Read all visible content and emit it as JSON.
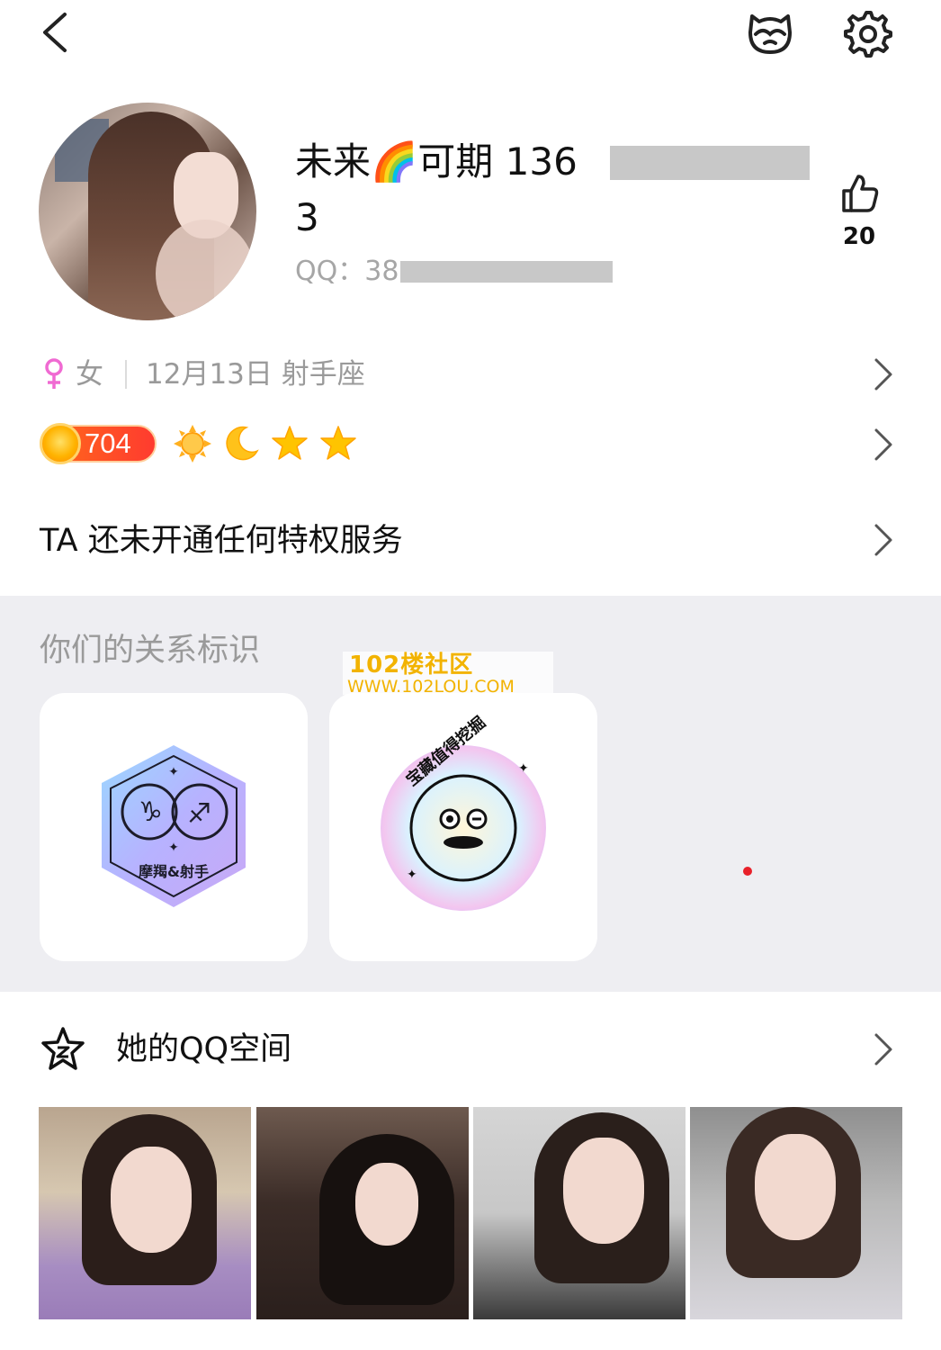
{
  "top_bar": {
    "back_icon": "chevron-left-icon",
    "pet_icon": "pet-face-icon",
    "settings_icon": "gear-icon"
  },
  "profile": {
    "name": "未来🌈可期 136",
    "name_cont": "3",
    "qq_label": "QQ：38",
    "like_count": "20"
  },
  "info": {
    "gender_symbol": "♀",
    "gender": "女",
    "birthday": "12月13日 射手座",
    "level": "704",
    "privilege": "TA 还未开通任何特权服务"
  },
  "relation": {
    "title": "你们的关系标识",
    "watermark_line1": "102楼社区",
    "watermark_line2": "WWW.102LOU.COM",
    "cards": [
      {
        "badge_label": "摩羯&射手",
        "icon": "zodiac-badge-icon"
      },
      {
        "badge_label": "宝藏值得挖掘",
        "icon": "treasure-badge-icon"
      }
    ]
  },
  "qzone": {
    "title": "她的QQ空间"
  },
  "colors": {
    "accent_orange": "#ff5a1f",
    "section_bg": "#eeeef2",
    "muted_text": "#9a9a9a",
    "gender_pink": "#f06ad2",
    "star_yellow": "#ffc400"
  }
}
